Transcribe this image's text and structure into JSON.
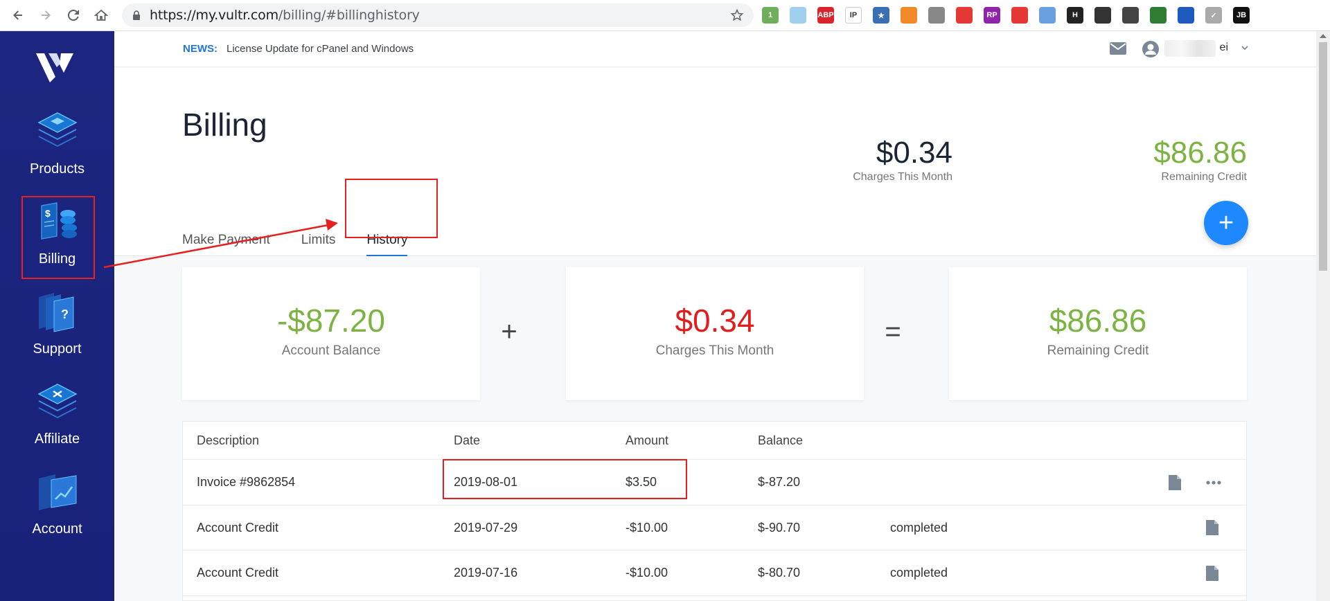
{
  "browser": {
    "url_host": "https://my.vultr.com",
    "url_path": "/billing/#billinghistory",
    "extensions": [
      {
        "name": "notification-extension",
        "color": "#6fae5a",
        "label": "1"
      },
      {
        "name": "cloud-extension",
        "color": "#9fd0f0",
        "label": ""
      },
      {
        "name": "adblock-extension",
        "color": "#d8242a",
        "label": "ABP"
      },
      {
        "name": "ip-extension",
        "color": "#ffffff",
        "label": "IP"
      },
      {
        "name": "bookmark-star-extension",
        "color": "#3a6fb3",
        "label": "★"
      },
      {
        "name": "metamask-extension",
        "color": "#f28a2a",
        "label": ""
      },
      {
        "name": "parachute-extension",
        "color": "#888888",
        "label": ""
      },
      {
        "name": "refresh-extension",
        "color": "#e53935",
        "label": ""
      },
      {
        "name": "rp-extension",
        "color": "#8e24aa",
        "label": "RP"
      },
      {
        "name": "weibo-extension",
        "color": "#e53935",
        "label": ""
      },
      {
        "name": "compass-extension",
        "color": "#6aa0e0",
        "label": ""
      },
      {
        "name": "code-extension",
        "color": "#222222",
        "label": "H"
      },
      {
        "name": "aperture-extension",
        "color": "#333333",
        "label": ""
      },
      {
        "name": "cat-extension",
        "color": "#444444",
        "label": ""
      },
      {
        "name": "leaf-extension",
        "color": "#2e7d32",
        "label": ""
      },
      {
        "name": "globe-extension",
        "color": "#1e5bbd",
        "label": ""
      },
      {
        "name": "check-extension",
        "color": "#aaaaaa",
        "label": "✓"
      },
      {
        "name": "jb-extension",
        "color": "#111111",
        "label": "JB"
      }
    ]
  },
  "sidebar": {
    "items": [
      {
        "label": "Products"
      },
      {
        "label": "Billing"
      },
      {
        "label": "Support"
      },
      {
        "label": "Affiliate"
      },
      {
        "label": "Account"
      }
    ]
  },
  "topbar": {
    "news_tag": "NEWS:",
    "news_text": "License Update for cPanel and Windows",
    "user_suffix": "ei"
  },
  "header": {
    "title": "Billing",
    "charges": {
      "value": "$0.34",
      "label": "Charges This Month"
    },
    "remaining": {
      "value": "$86.86",
      "label": "Remaining Credit"
    },
    "tabs": [
      {
        "label": "Make Payment"
      },
      {
        "label": "Limits"
      },
      {
        "label": "History"
      }
    ],
    "fab": "+"
  },
  "cards": [
    {
      "value": "-$87.20",
      "label": "Account Balance"
    },
    {
      "value": "$0.34",
      "label": "Charges This Month"
    },
    {
      "value": "$86.86",
      "label": "Remaining Credit"
    }
  ],
  "operators": {
    "plus": "+",
    "equals": "="
  },
  "table": {
    "headers": [
      "Description",
      "Date",
      "Amount",
      "Balance"
    ],
    "rows": [
      {
        "description": "Invoice #9862854",
        "date": "2019-08-01",
        "amount": "$3.50",
        "balance": "$-87.20",
        "status": ""
      },
      {
        "description": "Account Credit",
        "date": "2019-07-29",
        "amount": "-$10.00",
        "balance": "$-90.70",
        "status": "completed"
      },
      {
        "description": "Account Credit",
        "date": "2019-07-16",
        "amount": "-$10.00",
        "balance": "$-80.70",
        "status": "completed"
      }
    ]
  },
  "colors": {
    "sidebar": "#1a237e",
    "accent": "#1f75de",
    "green": "#7cb342",
    "red": "#e21d1d",
    "annotation": "#e5201f"
  }
}
